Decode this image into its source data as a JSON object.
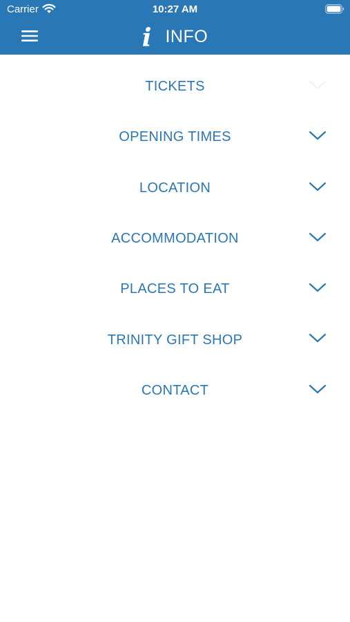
{
  "status_bar": {
    "carrier": "Carrier",
    "time": "10:27 AM",
    "wifi_icon": "wifi-icon",
    "battery_icon": "battery-icon"
  },
  "nav": {
    "menu_icon": "hamburger-menu-icon",
    "info_icon_glyph": "i",
    "title": "INFO"
  },
  "colors": {
    "accent": "#2a77b5",
    "background": "#ffffff",
    "faded_chevron": "#eef3f8"
  },
  "sections": [
    {
      "label": "TICKETS",
      "icon": "chevron-down-icon",
      "highlighted": true
    },
    {
      "label": "OPENING TIMES",
      "icon": "chevron-down-icon"
    },
    {
      "label": "LOCATION",
      "icon": "chevron-down-icon"
    },
    {
      "label": "ACCOMMODATION",
      "icon": "chevron-down-icon"
    },
    {
      "label": "PLACES TO EAT",
      "icon": "chevron-down-icon"
    },
    {
      "label": "TRINITY GIFT SHOP",
      "icon": "chevron-down-icon"
    },
    {
      "label": "CONTACT",
      "icon": "chevron-down-icon"
    }
  ]
}
